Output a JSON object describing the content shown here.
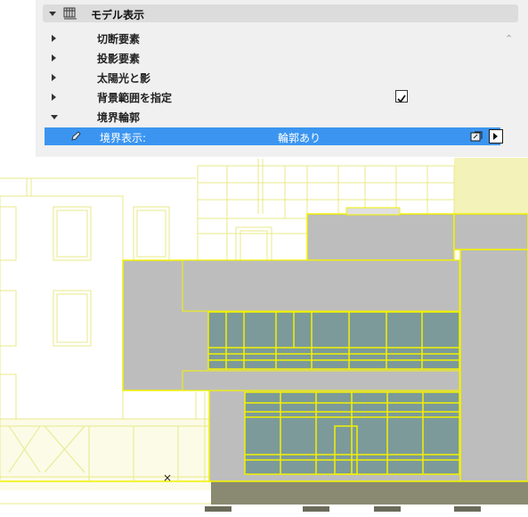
{
  "panel": {
    "header_title": "モデル表示",
    "rows": [
      {
        "label": "切断要素"
      },
      {
        "label": "投影要素"
      },
      {
        "label": "太陽光と影"
      },
      {
        "label": "背景範囲を指定",
        "checked": true
      },
      {
        "label": "境界輪郭",
        "expanded": true
      }
    ],
    "selected_row": {
      "label": "境界表示:",
      "value": "輪郭あり"
    }
  },
  "viewport": {
    "marker": "×"
  },
  "colors": {
    "selection": "#3b95f0",
    "wireframe": "#e9e98a",
    "highlight": "#f2f200",
    "wall": "#bdbdbd",
    "glass": "#7c9a9a",
    "ground": "#8a8a72",
    "tint": "#f3f2b8"
  }
}
